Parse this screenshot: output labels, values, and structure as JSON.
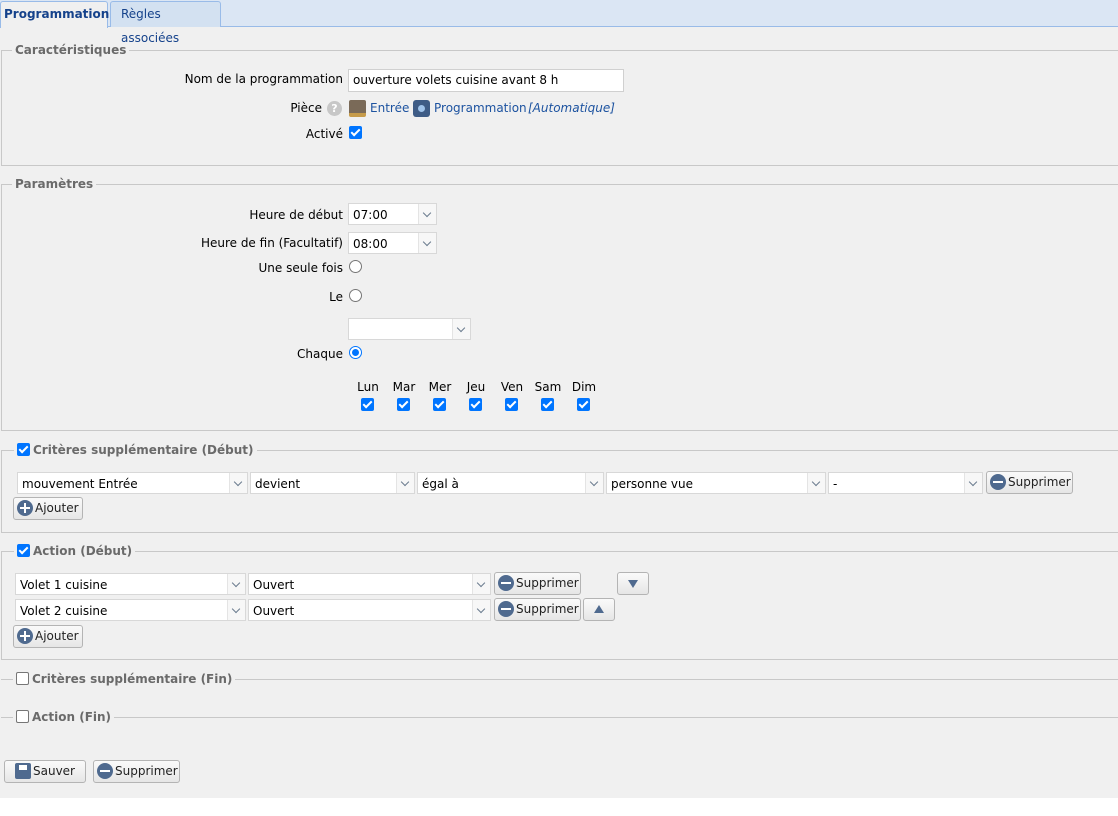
{
  "tabs": [
    {
      "label": "Programmation",
      "active": true
    },
    {
      "label": "Règles associées",
      "active": false
    }
  ],
  "caracteristiques": {
    "legend": "Caractéristiques",
    "nom_label": "Nom de la programmation",
    "nom_value": "ouverture volets cuisine avant 8 h",
    "piece_label": "Pièce",
    "piece_room": "Entrée",
    "piece_type": "Programmation",
    "piece_mode": "[Automatique]",
    "active_label": "Activé",
    "active_checked": true
  },
  "parametres": {
    "legend": "Paramètres",
    "debut_label": "Heure de début",
    "debut_value": "07:00",
    "fin_label": "Heure de fin (Facultatif)",
    "fin_value": "08:00",
    "une_seule_label": "Une seule fois",
    "le_label": "Le",
    "le_value": "",
    "chaque_label": "Chaque",
    "days": [
      "Lun",
      "Mar",
      "Mer",
      "Jeu",
      "Ven",
      "Sam",
      "Dim"
    ],
    "days_checked": [
      true,
      true,
      true,
      true,
      true,
      true,
      true
    ]
  },
  "criteres_debut": {
    "legend": "Critères supplémentaire (Début)",
    "checked": true,
    "rows": [
      {
        "device": "mouvement Entrée",
        "event": "devient",
        "operator": "égal à",
        "value": "personne vue",
        "extra": "-"
      }
    ],
    "delete_label": "Supprimer",
    "add_label": "Ajouter"
  },
  "action_debut": {
    "legend": "Action (Début)",
    "checked": true,
    "rows": [
      {
        "device": "Volet 1 cuisine",
        "state": "Ouvert"
      },
      {
        "device": "Volet 2 cuisine",
        "state": "Ouvert"
      }
    ],
    "delete_label": "Supprimer",
    "add_label": "Ajouter"
  },
  "criteres_fin": {
    "legend": "Critères supplémentaire (Fin)",
    "checked": false
  },
  "action_fin": {
    "legend": "Action (Fin)",
    "checked": false
  },
  "footer": {
    "save_label": "Sauver",
    "delete_label": "Supprimer"
  },
  "colors": {
    "accent": "#0075ff",
    "tab_text": "#15428b",
    "link": "#1d53a0",
    "icon": "#4f6a8f"
  }
}
